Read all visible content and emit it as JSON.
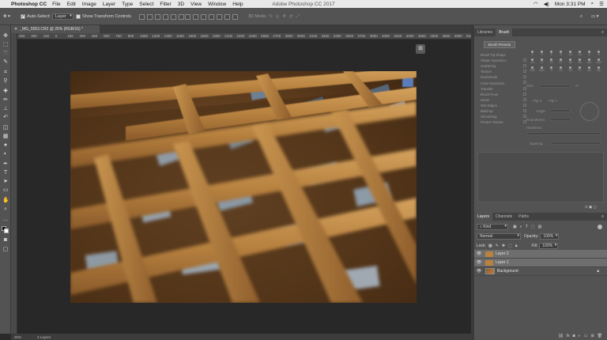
{
  "menubar": {
    "app_name": "Photoshop CC",
    "items": [
      "File",
      "Edit",
      "Image",
      "Layer",
      "Type",
      "Select",
      "Filter",
      "3D",
      "View",
      "Window",
      "Help"
    ],
    "window_title": "Adobe Photoshop CC 2017",
    "clock": "Mon 3:31 PM"
  },
  "options_bar": {
    "auto_select_label": "Auto-Select:",
    "auto_select_value": "Layer",
    "transform_controls_label": "Show Transform Controls",
    "mode_3d_label": "3D Mode:"
  },
  "document": {
    "tab_label": "_MG_5053.CR2 @ 25% (RGB/16) *",
    "zoom": "25%",
    "status_info": "3 Layers"
  },
  "ruler": {
    "top_ticks": [
      "450",
      "300",
      "150",
      "0",
      "150",
      "300",
      "450",
      "600",
      "750",
      "900",
      "1050",
      "1200",
      "1350",
      "1500",
      "1650",
      "1800",
      "1950",
      "2100",
      "2250",
      "2400",
      "2550",
      "2700",
      "2850",
      "3000",
      "3150",
      "3300",
      "3450",
      "3600",
      "3750",
      "3900",
      "4050",
      "4200",
      "4350",
      "4500",
      "4650",
      "4800",
      "4950",
      "5100"
    ]
  },
  "right_panel": {
    "top_tabs": [
      "Libraries",
      "Brush"
    ],
    "brush_presets_button": "Brush Presets",
    "brush_options": [
      "Brush Tip Shape",
      "Shape Dynamics",
      "Scattering",
      "Texture",
      "Dual Brush",
      "Color Dynamics",
      "Transfer",
      "Brush Pose",
      "Noise",
      "Wet Edges",
      "Build-up",
      "Smoothing",
      "Protect Texture"
    ],
    "brush_sizes": [
      "1",
      "3",
      "5",
      "9",
      "13",
      "19",
      "5",
      "9",
      "13",
      "17",
      "21",
      "27",
      "35",
      "45",
      "65",
      "100",
      "200",
      "300",
      "9",
      "13",
      "19",
      "17",
      "45",
      "65"
    ],
    "size_label": "Size",
    "flip_x": "Flip X",
    "flip_y": "Flip Y",
    "angle_label": "Angle:",
    "roundness_label": "Roundness:",
    "hardness_label": "Hardness",
    "spacing_label": "Spacing"
  },
  "layers_panel": {
    "tabs": [
      "Layers",
      "Channels",
      "Paths"
    ],
    "kind_filter": "Kind",
    "blend_mode": "Normal",
    "opacity_label": "Opacity:",
    "opacity_value": "100%",
    "lock_label": "Lock:",
    "fill_label": "Fill:",
    "fill_value": "100%",
    "layers": [
      {
        "name": "Layer 2",
        "selected": true,
        "type": "layer"
      },
      {
        "name": "Layer 1",
        "selected": true,
        "type": "layer"
      },
      {
        "name": "Background",
        "selected": false,
        "type": "background"
      }
    ]
  },
  "colors": {
    "accent_selected_layer": "#6e6e6e",
    "canvas_bg": "#282828",
    "panel_bg": "#535353"
  }
}
